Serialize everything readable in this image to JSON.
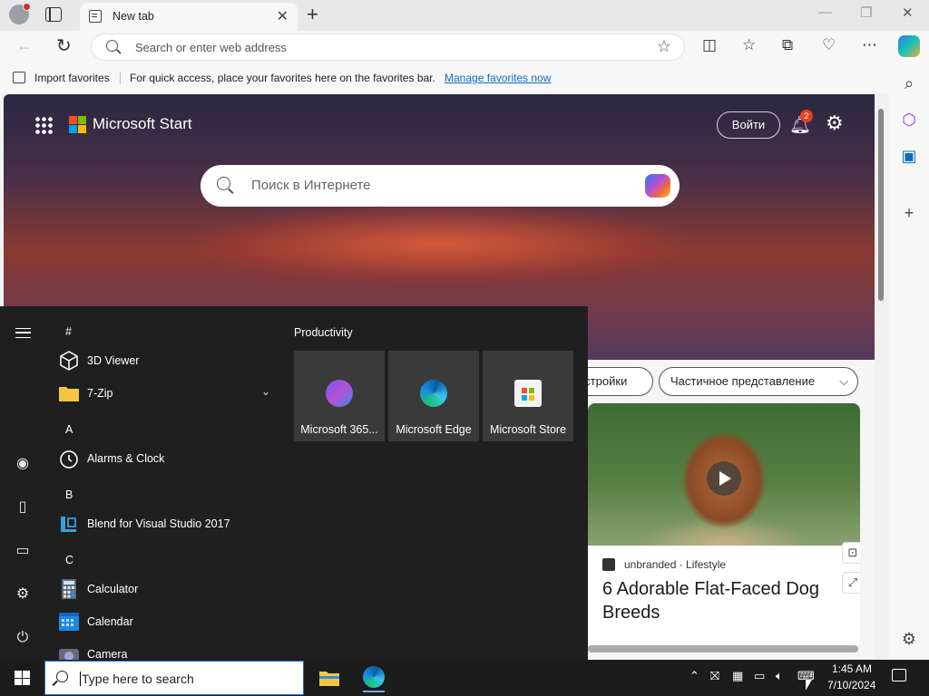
{
  "browser": {
    "tab_title": "New tab",
    "address_placeholder": "Search or enter web address",
    "favorites_bar": {
      "import_label": "Import favorites",
      "message": "For quick access, place your favorites here on the favorites bar.",
      "manage_link": "Manage favorites now"
    }
  },
  "msstart": {
    "brand": "Microsoft Start",
    "signin_label": "Войти",
    "notification_count": "2",
    "search_placeholder": "Поиск в Интернете",
    "pills": [
      "астройки",
      "Частичное представление"
    ],
    "card": {
      "source": "unbranded · Lifestyle",
      "headline": "6 Adorable Flat-Faced Dog Breeds"
    }
  },
  "start_menu": {
    "groups": [
      {
        "letter": "#",
        "apps": [
          "3D Viewer",
          "7-Zip"
        ]
      },
      {
        "letter": "A",
        "apps": [
          "Alarms & Clock"
        ]
      },
      {
        "letter": "B",
        "apps": [
          "Blend for Visual Studio 2017"
        ]
      },
      {
        "letter": "C",
        "apps": [
          "Calculator",
          "Calendar",
          "Camera"
        ]
      }
    ],
    "tiles_heading": "Productivity",
    "tiles": [
      "Microsoft 365...",
      "Microsoft Edge",
      "Microsoft Store"
    ]
  },
  "taskbar": {
    "search_placeholder": "Type here to search",
    "time": "1:45 AM",
    "date": "7/10/2024"
  },
  "colors": {
    "accent_link": "#0f6cbd",
    "start_bg": "#1f1f1f",
    "tile_bg": "#3a3a3a",
    "notification_badge": "#e8431e"
  }
}
